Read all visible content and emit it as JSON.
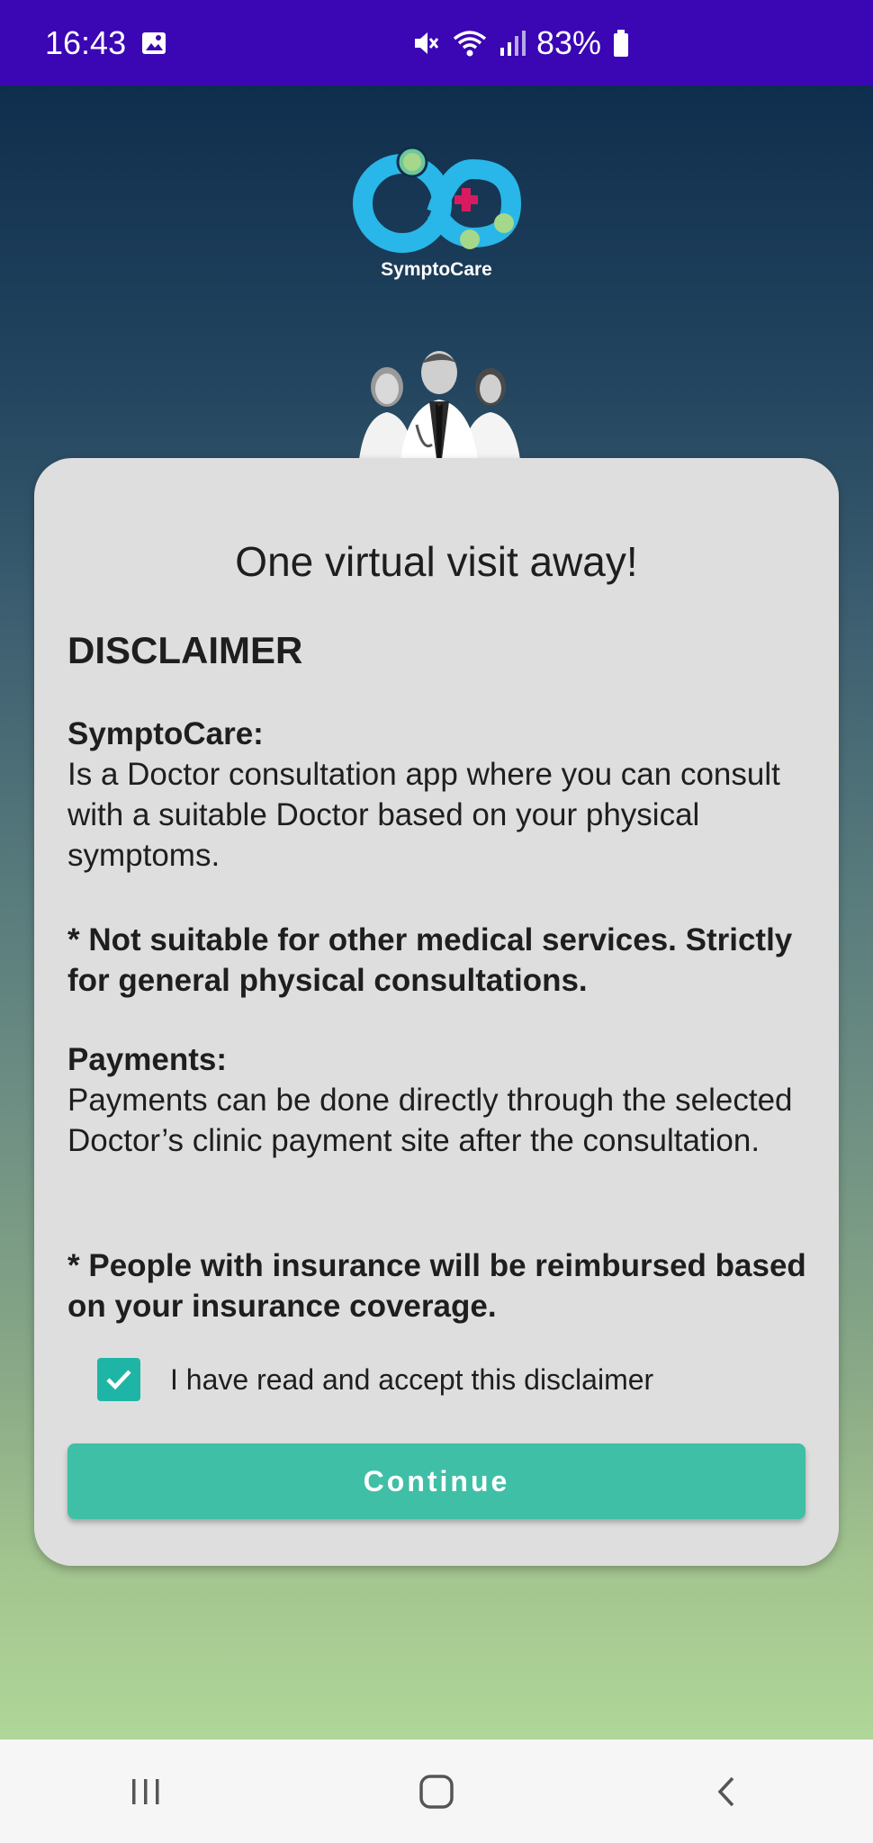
{
  "status_bar": {
    "time": "16:43",
    "battery": "83%",
    "icons": [
      "image-icon",
      "mute-icon",
      "wifi-icon",
      "signal-icon",
      "battery-icon"
    ]
  },
  "app": {
    "logo_text": "SymptoCare",
    "colors": {
      "accent": "#3fbfa6",
      "status_bar": "#3b06b3",
      "card": "#dedede",
      "logo_blue": "#29b6e8",
      "logo_cross": "#d81b60",
      "logo_green": "#a5d88a"
    }
  },
  "card": {
    "headline": "One virtual visit away!",
    "disclaimer_title": "DISCLAIMER",
    "sections": [
      {
        "heading": "SymptoCare:",
        "text": "Is a Doctor consultation app where  you can consult with a suitable Doctor based on your physical symptoms."
      },
      {
        "note": "* Not suitable for other medical services. Strictly for general physical consultations."
      },
      {
        "heading": "Payments:",
        "text": "Payments can be done directly through the selected Doctor’s clinic payment site after the consultation."
      },
      {
        "note": "* People with insurance will be reimbursed based on your insurance coverage."
      }
    ],
    "checkbox": {
      "label": "I have read and accept this disclaimer",
      "checked": true
    },
    "continue_label": "Continue"
  },
  "nav_bar": {
    "items": [
      "recent-apps-icon",
      "home-icon",
      "back-icon"
    ]
  }
}
